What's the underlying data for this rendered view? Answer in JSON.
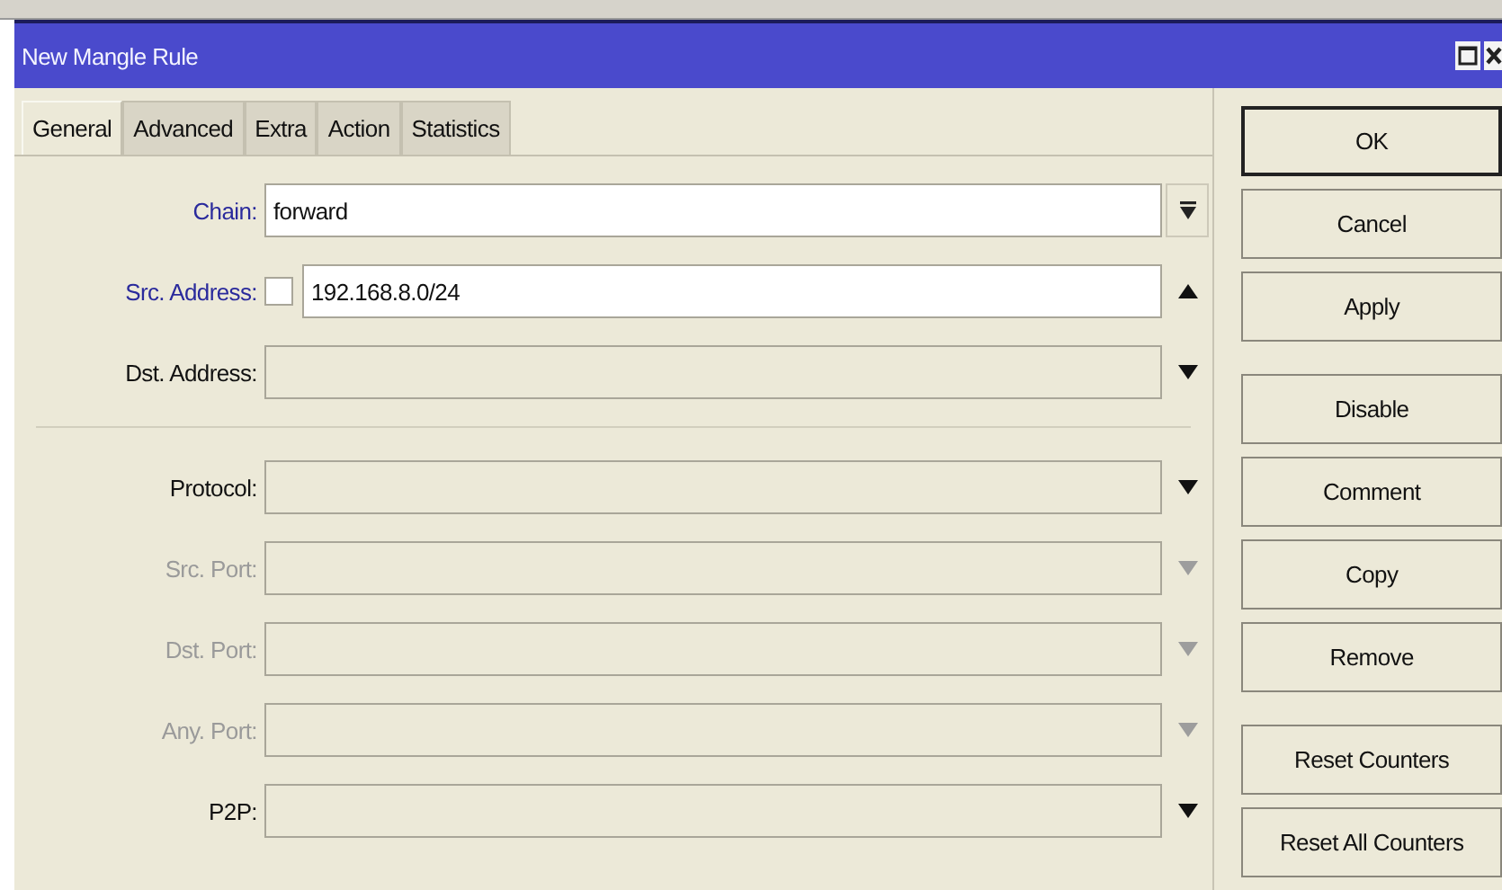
{
  "window": {
    "title": "New Mangle Rule"
  },
  "tabs": [
    {
      "label": "General",
      "selected": true
    },
    {
      "label": "Advanced",
      "selected": false
    },
    {
      "label": "Extra",
      "selected": false
    },
    {
      "label": "Action",
      "selected": false
    },
    {
      "label": "Statistics",
      "selected": false
    }
  ],
  "sections": [
    {
      "fields": [
        {
          "kind": "combo",
          "label": "Chain:",
          "value": "forward",
          "set": true,
          "disabled": false
        },
        {
          "kind": "address",
          "label": "Src. Address:",
          "value": "192.168.8.0/24",
          "set": true,
          "disabled": false,
          "checked": false
        },
        {
          "kind": "choice",
          "label": "Dst. Address:",
          "set": false,
          "disabled": false
        }
      ]
    },
    {
      "fields": [
        {
          "kind": "choice",
          "label": "Protocol:",
          "set": false,
          "disabled": false
        },
        {
          "kind": "choice",
          "label": "Src. Port:",
          "set": false,
          "disabled": true
        },
        {
          "kind": "choice",
          "label": "Dst. Port:",
          "set": false,
          "disabled": true
        },
        {
          "kind": "choice",
          "label": "Any. Port:",
          "set": false,
          "disabled": true
        },
        {
          "kind": "choice",
          "label": "P2P:",
          "set": false,
          "disabled": false
        }
      ]
    }
  ],
  "button_groups": [
    [
      {
        "label": "OK",
        "default": true
      },
      {
        "label": "Cancel",
        "default": false
      },
      {
        "label": "Apply",
        "default": false
      }
    ],
    [
      {
        "label": "Disable",
        "default": false
      },
      {
        "label": "Comment",
        "default": false
      },
      {
        "label": "Copy",
        "default": false
      },
      {
        "label": "Remove",
        "default": false
      }
    ],
    [
      {
        "label": "Reset Counters",
        "default": false
      },
      {
        "label": "Reset All Counters",
        "default": false
      }
    ]
  ]
}
